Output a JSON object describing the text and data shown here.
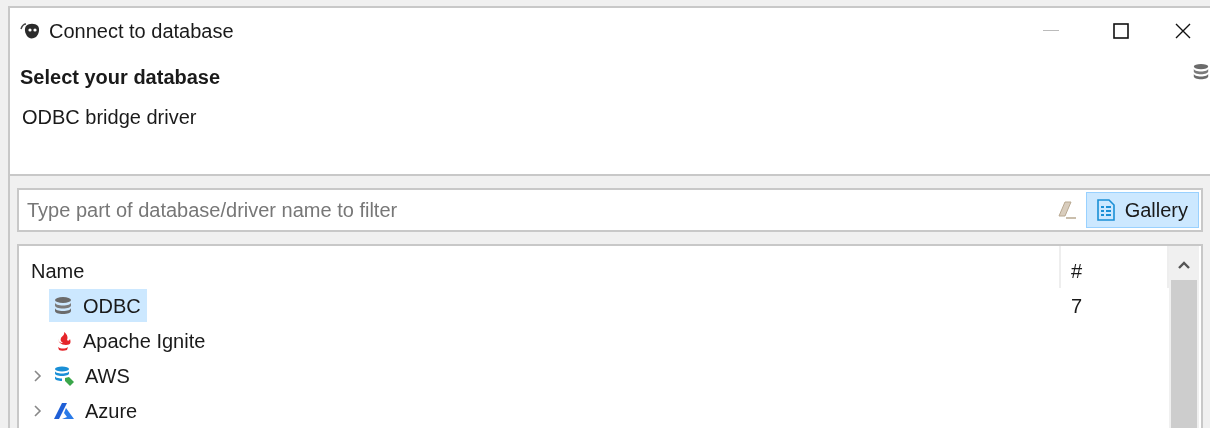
{
  "window": {
    "title": "Connect to database"
  },
  "header": {
    "title": "Select your database",
    "subtitle": "ODBC bridge driver"
  },
  "filter": {
    "placeholder": "Type part of database/driver name to filter",
    "gallery_button": {
      "label": "Gallery",
      "selected": true
    }
  },
  "table": {
    "columns": [
      "Name",
      "#"
    ],
    "rows": [
      {
        "name": "ODBC",
        "count": "7",
        "kind": "driver",
        "selected": true
      },
      {
        "name": "Apache Ignite",
        "kind": "driver",
        "selected": false
      },
      {
        "name": "AWS",
        "kind": "folder",
        "expanded": false,
        "selected": false
      },
      {
        "name": "Azure",
        "kind": "folder",
        "expanded": false,
        "selected": false
      }
    ]
  }
}
